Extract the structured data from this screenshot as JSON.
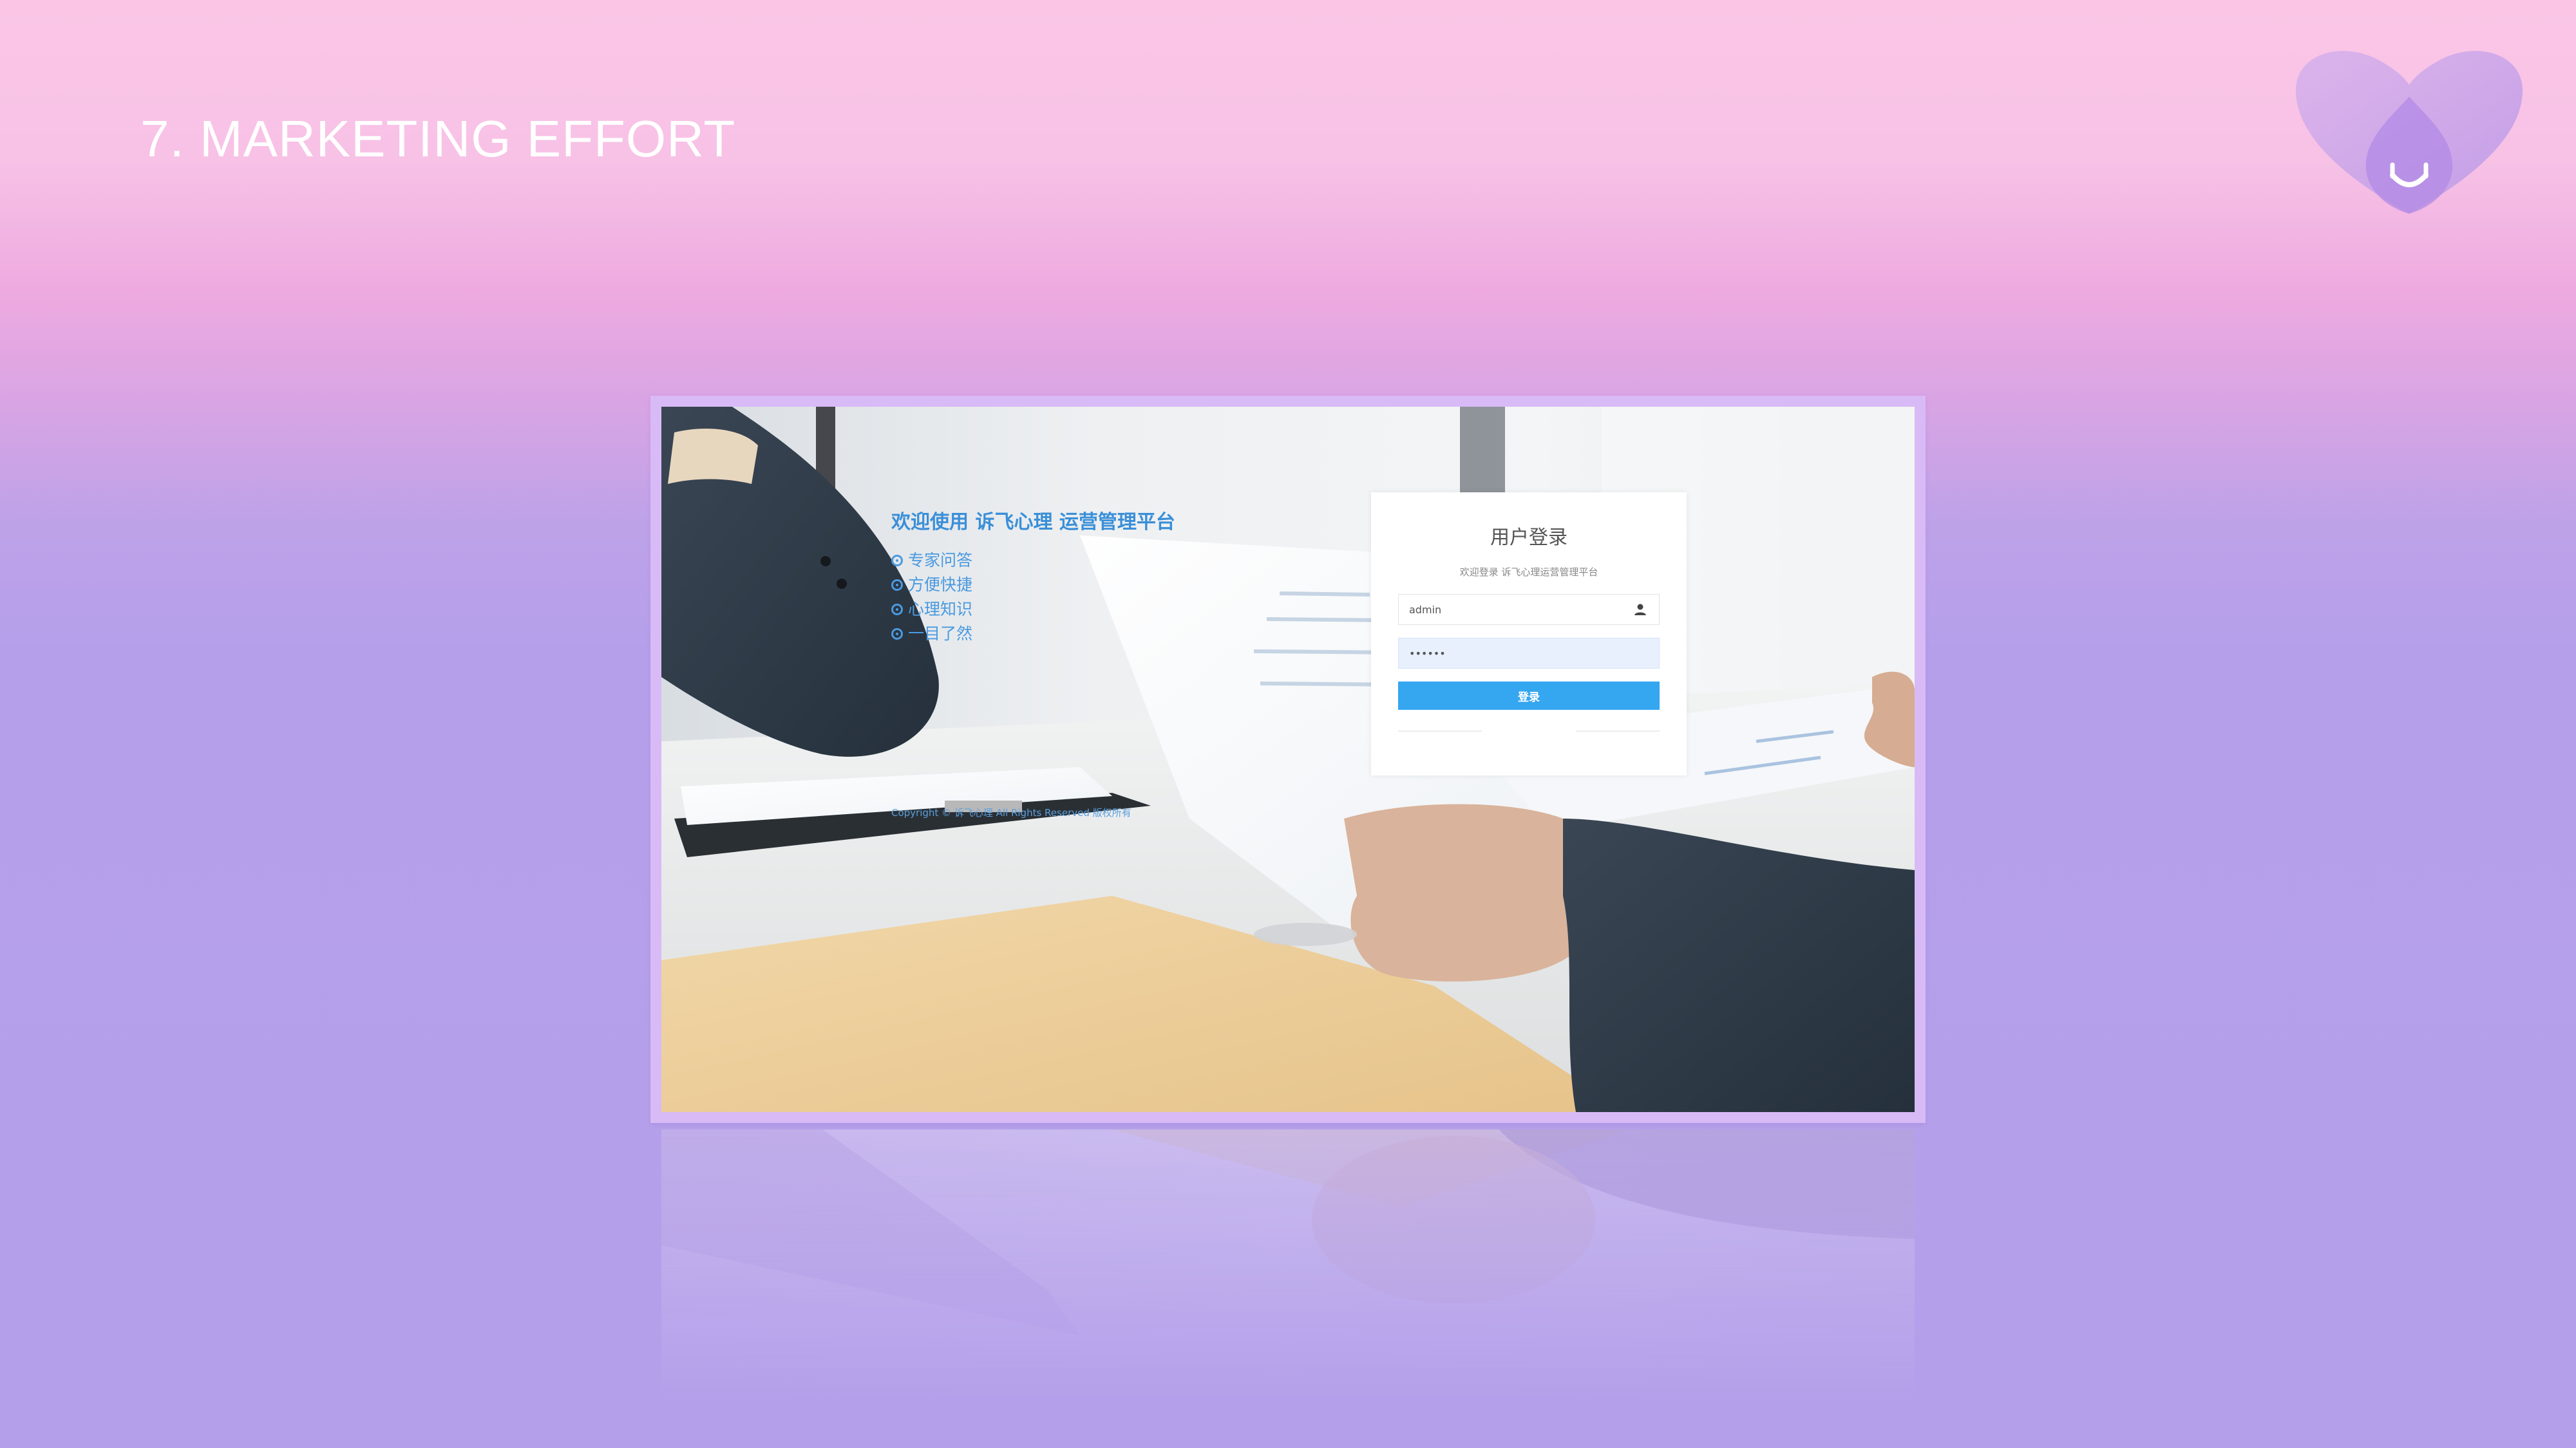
{
  "slide": {
    "title": "7. MARKETING EFFORT"
  },
  "login_page": {
    "welcome_text": "欢迎使用 诉飞心理 运营管理平台",
    "features": [
      "专家问答",
      "方便快捷",
      "心理知识",
      "一目了然"
    ],
    "copyright": "Copyright © 诉飞心理 All Rights Reserved 版权所有",
    "card": {
      "title": "用户登录",
      "subtitle": "欢迎登录 诉飞心理运营管理平台",
      "username_value": "admin",
      "password_value": "••••••",
      "login_button": "登录"
    }
  },
  "colors": {
    "accent_blue": "#35a6f0",
    "frame_border": "#d8baf6",
    "logo_purple": "#b896e8"
  },
  "icons": {
    "logo": "heart-face-logo",
    "user": "user-icon"
  }
}
